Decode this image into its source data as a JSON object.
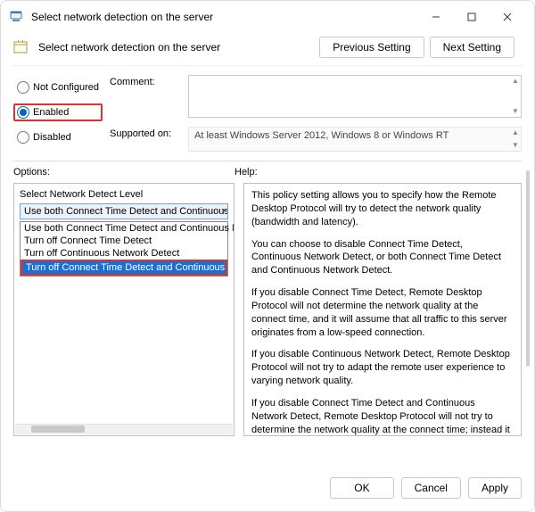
{
  "titlebar": {
    "title": "Select network detection on the server"
  },
  "subheader": {
    "title": "Select network detection on the server",
    "prev": "Previous Setting",
    "next": "Next Setting"
  },
  "state": {
    "not_configured": "Not Configured",
    "enabled": "Enabled",
    "disabled": "Disabled",
    "selected": "enabled"
  },
  "comment": {
    "label": "Comment:",
    "value": ""
  },
  "supported": {
    "label": "Supported on:",
    "text": "At least Windows Server 2012, Windows 8 or Windows RT"
  },
  "sections": {
    "options": "Options:",
    "help": "Help:"
  },
  "options_panel": {
    "label": "Select Network Detect Level",
    "selected": "Use both Connect Time Detect and Continuous Network Detect",
    "items": [
      "Use both Connect Time Detect and Continuous Network Detect",
      "Turn off Connect Time Detect",
      "Turn off Continuous Network Detect",
      "Turn off Connect Time Detect and Continuous Network Detect"
    ]
  },
  "help_text": {
    "p1": "This policy setting allows you to specify how the Remote Desktop Protocol will try to detect the network quality (bandwidth and latency).",
    "p2": "You can choose to disable Connect Time Detect, Continuous Network Detect, or both Connect Time Detect and Continuous Network Detect.",
    "p3": "If you disable Connect Time Detect, Remote Desktop Protocol will not determine the network quality at the connect time, and it will assume that all traffic to this server originates from a low-speed connection.",
    "p4": "If you disable Continuous Network Detect, Remote Desktop Protocol will not try to adapt the remote user experience to varying network quality.",
    "p5": "If you disable Connect Time Detect and Continuous Network Detect, Remote Desktop Protocol will not try to determine the network quality at the connect time; instead it will assume that all traffic to this server originates from a low-speed connection,"
  },
  "footer": {
    "ok": "OK",
    "cancel": "Cancel",
    "apply": "Apply"
  }
}
